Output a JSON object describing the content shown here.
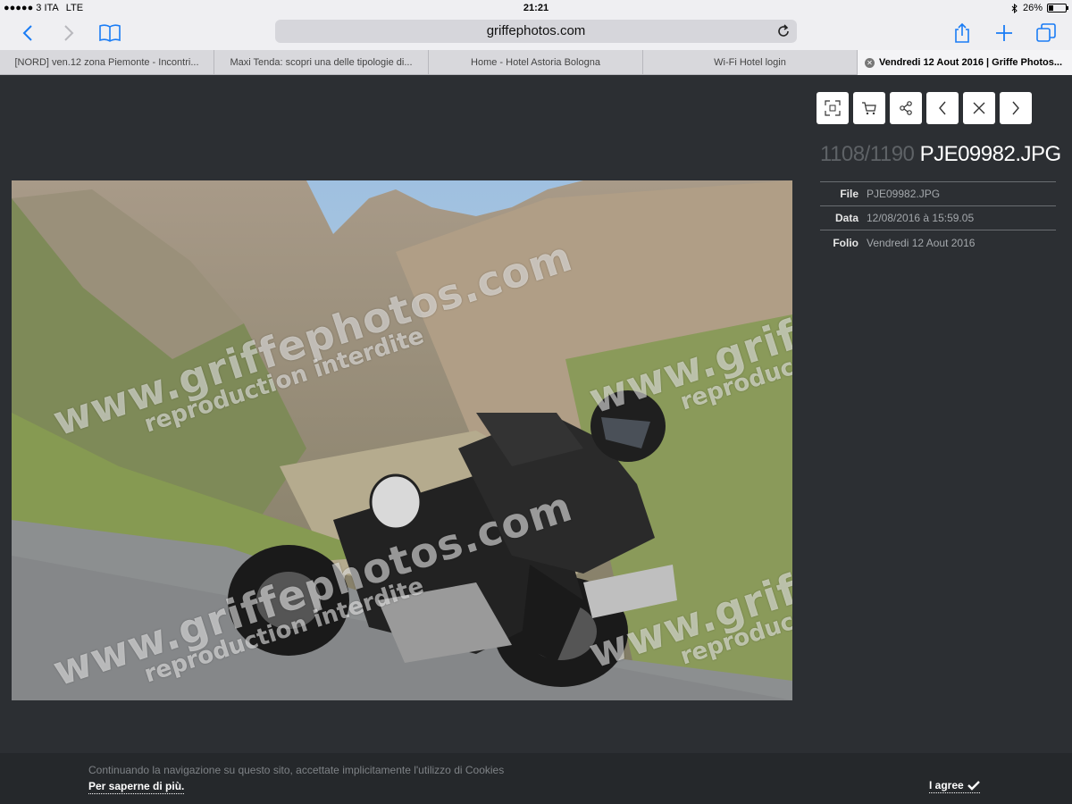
{
  "status_bar": {
    "carrier": "●●●●● 3 ITA",
    "network": "LTE",
    "time": "21:21",
    "battery_text": "26%",
    "battery_level": 0.26,
    "bluetooth_icon": "bluetooth-icon"
  },
  "toolbar": {
    "url": "griffephotos.com",
    "back_icon": "back-chevron-icon",
    "forward_icon": "forward-chevron-icon",
    "bookmarks_icon": "book-icon",
    "share_icon": "share-icon",
    "add_icon": "plus-icon",
    "tabs_icon": "tabs-icon",
    "reload_icon": "reload-icon",
    "accent_color": "#1a7cf5"
  },
  "tabs": [
    {
      "label": "[NORD] ven.12 zona Piemonte - Incontri..."
    },
    {
      "label": "Maxi Tenda: scopri una delle tipologie di..."
    },
    {
      "label": "Home - Hotel Astoria Bologna"
    },
    {
      "label": "Wi-Fi Hotel login"
    },
    {
      "label": "Vendredi 12 Aout 2016 | Griffe Photos..."
    }
  ],
  "viewer": {
    "counter": "1108/1190",
    "filename": "PJE09982.JPG",
    "watermark_main": "www.griffephotos.com",
    "watermark_sub": "reproduction interdite",
    "actions": [
      "fullscreen-icon",
      "cart-icon",
      "share-nodes-icon",
      "prev-chevron-icon",
      "close-icon",
      "next-chevron-icon"
    ],
    "meta": [
      {
        "key": "File",
        "value": "PJE09982.JPG"
      },
      {
        "key": "Data",
        "value": "12/08/2016 à 15:59.05"
      },
      {
        "key": "Folio",
        "value": "Vendredi 12 Aout 2016"
      }
    ]
  },
  "cookie": {
    "text": "Continuando la navigazione su questo sito, accettate implicitamente l'utilizzo di Cookies",
    "link": "Per saperne di più.",
    "agree": "I agree"
  }
}
